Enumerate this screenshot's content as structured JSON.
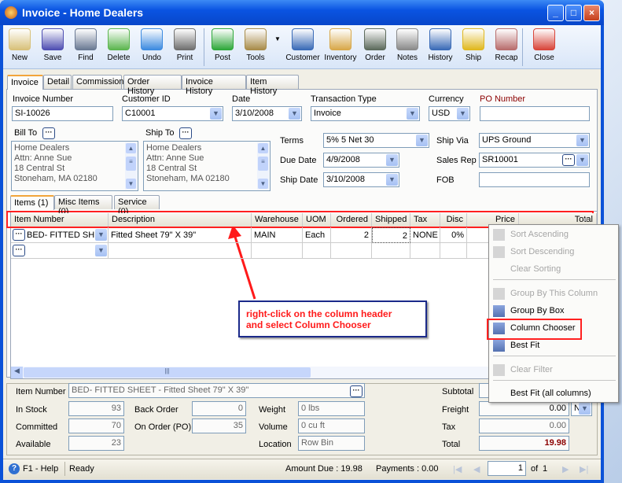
{
  "window": {
    "title": "Invoice - Home Dealers",
    "controls": [
      "_",
      "□",
      "×"
    ]
  },
  "toolbar": [
    {
      "label": "New",
      "icon": "new-document-icon",
      "color": "#d8c17a"
    },
    {
      "label": "Save",
      "icon": "floppy-disk-icon",
      "color": "#4f4fb2"
    },
    {
      "label": "Find",
      "icon": "binoculars-icon",
      "color": "#6a7a94"
    },
    {
      "label": "Delete",
      "icon": "recycle-bin-icon",
      "color": "#5cb64f"
    },
    {
      "label": "Undo",
      "icon": "undo-arrow-icon",
      "color": "#3d8be0"
    },
    {
      "label": "Print",
      "icon": "printer-icon",
      "color": "#707070"
    },
    {
      "label": "Post",
      "icon": "post-checkmark-icon",
      "color": "#2fa83a"
    },
    {
      "label": "Tools",
      "icon": "tools-icon",
      "color": "#a88c4a"
    },
    {
      "label": "Customer",
      "icon": "customer-person-icon",
      "color": "#3a6bb7"
    },
    {
      "label": "Inventory",
      "icon": "boxes-icon",
      "color": "#d8a84a"
    },
    {
      "label": "Order",
      "icon": "handheld-order-icon",
      "color": "#5d6b5d"
    },
    {
      "label": "Notes",
      "icon": "notepad-icon",
      "color": "#8a8a8a"
    },
    {
      "label": "History",
      "icon": "history-person-icon",
      "color": "#3a6bb7"
    },
    {
      "label": "Ship",
      "icon": "forklift-icon",
      "color": "#e0b81f"
    },
    {
      "label": "Recap",
      "icon": "recap-sheet-icon",
      "color": "#b86d6d"
    },
    {
      "label": "Close",
      "icon": "close-window-icon",
      "color": "#d8453a"
    }
  ],
  "tabs": [
    "Invoice",
    "Detail",
    "Commission",
    "Order History",
    "Invoice History",
    "Item History"
  ],
  "form": {
    "invoice_number": {
      "label": "Invoice Number",
      "value": "SI-10026"
    },
    "customer_id": {
      "label": "Customer ID",
      "value": "C10001"
    },
    "date": {
      "label": "Date",
      "value": "3/10/2008"
    },
    "transaction_type": {
      "label": "Transaction Type",
      "value": "Invoice"
    },
    "currency": {
      "label": "Currency",
      "value": "USD"
    },
    "po_number": {
      "label": "PO Number",
      "value": ""
    },
    "bill_to": {
      "label": "Bill To",
      "lines": [
        "Home Dealers",
        "Attn: Anne Sue",
        "18 Central St",
        "Stoneham, MA 02180"
      ]
    },
    "ship_to": {
      "label": "Ship To",
      "lines": [
        "Home Dealers",
        "Attn: Anne Sue",
        "18 Central St",
        "Stoneham, MA 02180"
      ]
    },
    "terms": {
      "label": "Terms",
      "value": "5% 5 Net 30"
    },
    "due_date": {
      "label": "Due Date",
      "value": "4/9/2008"
    },
    "ship_date": {
      "label": "Ship Date",
      "value": "3/10/2008"
    },
    "ship_via": {
      "label": "Ship Via",
      "value": "UPS Ground"
    },
    "sales_rep": {
      "label": "Sales Rep",
      "value": "SR10001"
    },
    "fob": {
      "label": "FOB",
      "value": ""
    }
  },
  "item_tabs": [
    "Items (1)",
    "Misc Items (0)",
    "Service (0)"
  ],
  "grid": {
    "columns": [
      "Item Number",
      "Description",
      "Warehouse",
      "UOM",
      "Ordered",
      "Shipped",
      "Tax",
      "Disc",
      "Price",
      "Total"
    ],
    "rows": [
      [
        "BED- FITTED SHEE",
        "Fitted Sheet 79\" X 39\"",
        "MAIN",
        "Each",
        "2",
        "2",
        "NONE",
        "0%",
        "",
        ""
      ]
    ]
  },
  "annotation": {
    "text_line1": "right-click on the column header",
    "text_line2": "and select Column Chooser"
  },
  "context_menu": [
    {
      "label": "Sort Ascending",
      "enabled": false,
      "icon": "sort-ascending-icon"
    },
    {
      "label": "Sort Descending",
      "enabled": false,
      "icon": "sort-descending-icon"
    },
    {
      "label": "Clear Sorting",
      "enabled": false,
      "icon": ""
    },
    {
      "label": "Group By This Column",
      "enabled": false,
      "icon": "group-by-column-icon"
    },
    {
      "label": "Group By Box",
      "enabled": true,
      "icon": "group-by-box-icon"
    },
    {
      "label": "Column Chooser",
      "enabled": true,
      "icon": "column-chooser-icon"
    },
    {
      "label": "Best Fit",
      "enabled": true,
      "icon": "best-fit-icon"
    },
    {
      "label": "Clear Filter",
      "enabled": false,
      "icon": "clear-filter-icon"
    },
    {
      "label": "Best Fit (all columns)",
      "enabled": true,
      "icon": ""
    }
  ],
  "detail": {
    "item_number": {
      "label": "Item Number",
      "value": "BED- FITTED SHEET - Fitted Sheet 79\" X 39\""
    },
    "in_stock": {
      "label": "In Stock",
      "value": "93"
    },
    "committed": {
      "label": "Committed",
      "value": "70"
    },
    "available": {
      "label": "Available",
      "value": "23"
    },
    "back_order": {
      "label": "Back Order",
      "value": "0"
    },
    "on_order": {
      "label": "On Order (PO)",
      "value": "35"
    },
    "weight": {
      "label": "Weight",
      "value": "0 lbs"
    },
    "volume": {
      "label": "Volume",
      "value": "0 cu ft"
    },
    "location": {
      "label": "Location",
      "value": "Row  Bin"
    },
    "subtotal": {
      "label": "Subtotal",
      "value": ""
    },
    "freight": {
      "label": "Freight",
      "value": "0.00",
      "flag": "N"
    },
    "tax": {
      "label": "Tax",
      "value": "0.00"
    },
    "total": {
      "label": "Total",
      "value": "19.98"
    }
  },
  "status": {
    "help": "F1 - Help",
    "state": "Ready",
    "amount_due": "Amount Due : 19.98",
    "payments": "Payments : 0.00",
    "page": "1",
    "of": "of",
    "page_total": "1"
  }
}
